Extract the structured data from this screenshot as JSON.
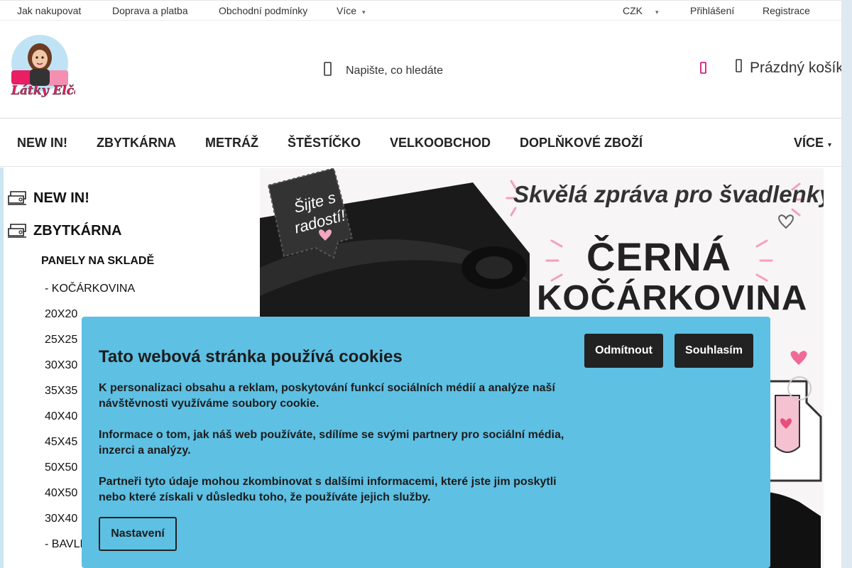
{
  "topbar": {
    "links": [
      "Jak nakupovat",
      "Doprava a platba",
      "Obchodní podmínky",
      "Více"
    ],
    "currency": "CZK",
    "login": "Přihlášení",
    "register": "Registrace"
  },
  "header": {
    "logo_text": "Látky Elča",
    "search_placeholder": "Napište, co hledáte",
    "cart_label": "Prázdný košík"
  },
  "mainnav": {
    "items": [
      "NEW IN!",
      "ZBYTKÁRNA",
      "METRÁŽ",
      "ŠTĚSTÍČKO",
      "VELKOOBCHOD",
      "DOPLŇKOVÉ ZBOŽÍ"
    ],
    "more": "VÍCE"
  },
  "sidebar": {
    "main": [
      "NEW IN!",
      "ZBYTKÁRNA"
    ],
    "sub": "PANELY NA SKLADĚ",
    "leaves": [
      "- KOČÁRKOVINA",
      "20X20",
      "25X25",
      "30X30",
      "35X35",
      "40X40",
      "45X45",
      "50X50",
      "40X50",
      "30X40",
      "- BAVLN"
    ]
  },
  "banner": {
    "tag": "Šijte s radostí!",
    "headline": "Skvělá zpráva pro švadlenky!",
    "line1": "ČERNÁ",
    "line2": "KOČÁRKOVINA"
  },
  "cookie": {
    "title": "Tato webová stránka používá cookies",
    "p1": "K personalizaci obsahu a reklam, poskytování funkcí sociálních médií a analýze naší návštěvnosti využíváme soubory cookie.",
    "p2": "Informace o tom, jak náš web používáte, sdílíme se svými partnery pro sociální média, inzerci a analýzy.",
    "p3": "Partneři tyto údaje mohou zkombinovat s dalšími informacemi, které jste jim poskytli nebo které získali v důsledku toho, že používáte jejich služby.",
    "reject": "Odmítnout",
    "accept": "Souhlasím",
    "settings": "Nastavení"
  },
  "colors": {
    "cookie_bg": "#5ec0e3",
    "heart": "#d1006b",
    "button_dark": "#222222"
  }
}
